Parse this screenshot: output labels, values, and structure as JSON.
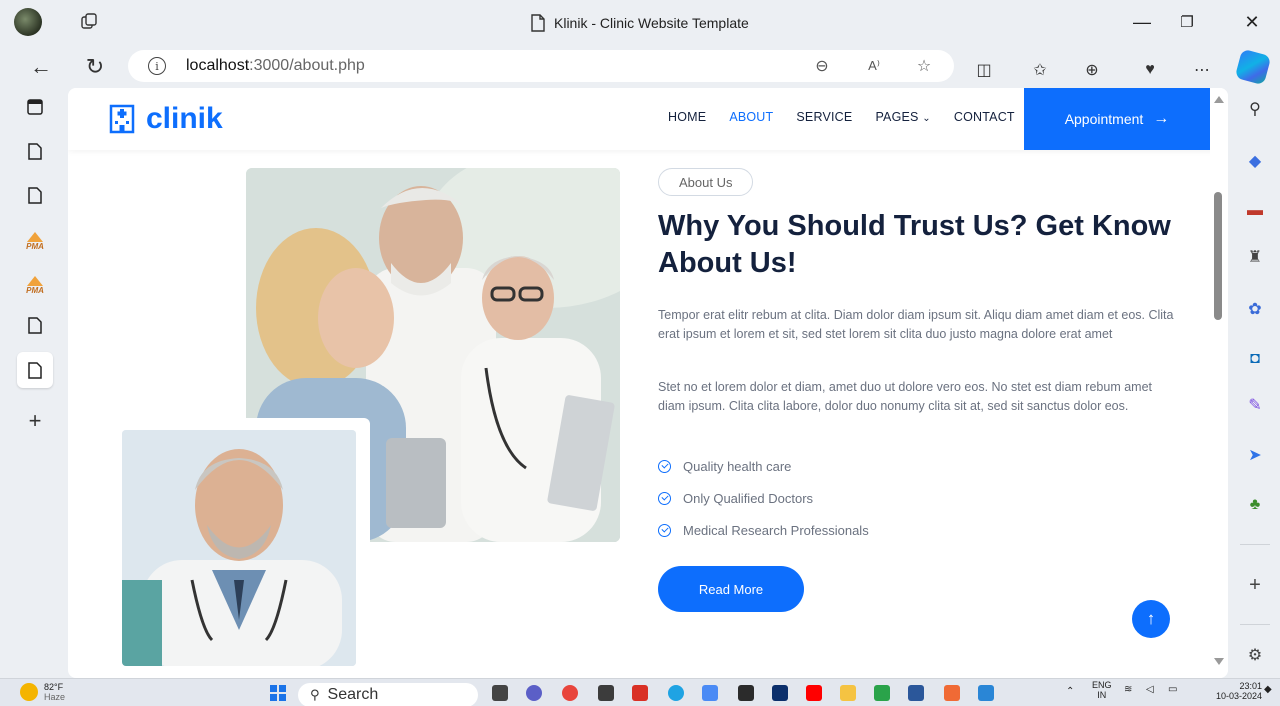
{
  "browser": {
    "window_title": "Klinik - Clinic Website Template",
    "url_host": "localhost",
    "url_path": ":3000/about.php",
    "window_controls": {
      "minimize": "—",
      "restore": "❐",
      "close": "✕"
    }
  },
  "site": {
    "logo_text": "clinik",
    "nav": [
      {
        "label": "HOME",
        "active": false
      },
      {
        "label": "ABOUT",
        "active": true
      },
      {
        "label": "SERVICE",
        "active": false
      },
      {
        "label": "PAGES",
        "active": false,
        "has_dropdown": true
      },
      {
        "label": "CONTACT",
        "active": false
      }
    ],
    "appointment_label": "Appointment",
    "accent_color": "#0d6efd",
    "heading_color": "#14213d"
  },
  "about": {
    "pill": "About Us",
    "heading": "Why You Should Trust Us? Get Know About Us!",
    "para1": "Tempor erat elitr rebum at clita. Diam dolor diam ipsum sit. Aliqu diam amet diam et eos. Clita erat ipsum et lorem et sit, sed stet lorem sit clita duo justo magna dolore erat amet",
    "para2": "Stet no et lorem dolor et diam, amet duo ut dolore vero eos. No stet est diam rebum amet diam ipsum. Clita clita labore, dolor duo nonumy clita sit at, sed sit sanctus dolor eos.",
    "features": [
      "Quality health care",
      "Only Qualified Doctors",
      "Medical Research Professionals"
    ],
    "read_more": "Read More"
  },
  "taskbar": {
    "temperature": "82°F",
    "weather_sub": "Haze",
    "search_label": "Search",
    "lang_top": "ENG",
    "lang_bottom": "IN",
    "time": "23:01",
    "date": "10-03-2024"
  }
}
